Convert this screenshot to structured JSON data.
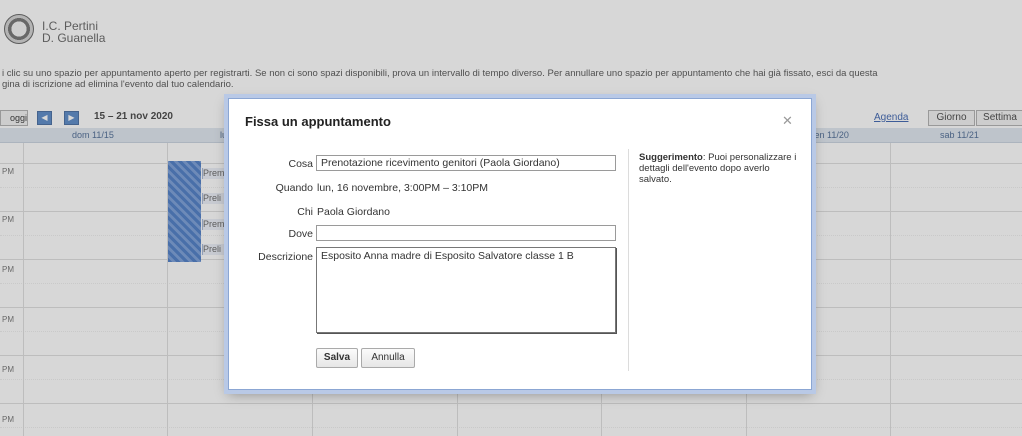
{
  "header": {
    "org_line1": "I.C. Pertini",
    "org_line2": "D. Guanella",
    "intro_line1": "i clic su uno spazio per appuntamento aperto per registrarti. Se non ci sono spazi disponibili, prova un intervallo di tempo diverso. Per annullare uno spazio per appuntamento che hai già fissato, esci da questa",
    "intro_line2": "gina di iscrizione ad elimina l'evento dal tuo calendario."
  },
  "toolbar": {
    "today_label": "oggi",
    "prev_icon": "chevron-left-icon",
    "next_icon": "chevron-right-icon",
    "date_range": "15 – 21 nov 2020",
    "agenda_label": "Agenda",
    "views": [
      "Giorno",
      "Settima"
    ]
  },
  "calendar": {
    "days": [
      "dom 11/15",
      "lun 11/16",
      "",
      "",
      "",
      "ven 11/20",
      "sab 11/21"
    ],
    "times": [
      "PM",
      "PM",
      "PM",
      "PM",
      "PM",
      "PM"
    ],
    "events": [
      "Prem",
      "Preli",
      "Prem",
      "Preli"
    ]
  },
  "dialog": {
    "title": "Fissa un appuntamento",
    "close_icon": "close-icon",
    "fields": {
      "what_label": "Cosa",
      "what_value": "Prenotazione ricevimento genitori (Paola Giordano)",
      "when_label": "Quando",
      "when_value": "lun, 16 novembre, 3:00PM – 3:10PM",
      "who_label": "Chi",
      "who_value": "Paola Giordano",
      "where_label": "Dove",
      "where_value": "",
      "description_label": "Descrizione",
      "description_value": "Esposito Anna madre di Esposito Salvatore classe 1 B"
    },
    "buttons": {
      "save": "Salva",
      "cancel": "Annulla"
    },
    "hint": {
      "title": "Suggerimento",
      "text": "Puoi personalizzare i dettagli dell'evento dopo averlo salvato."
    }
  },
  "colors": {
    "accent": "#4a7fc2",
    "dialog_border": "#8ba6d3",
    "busy_slot": "#3b6fc0"
  }
}
